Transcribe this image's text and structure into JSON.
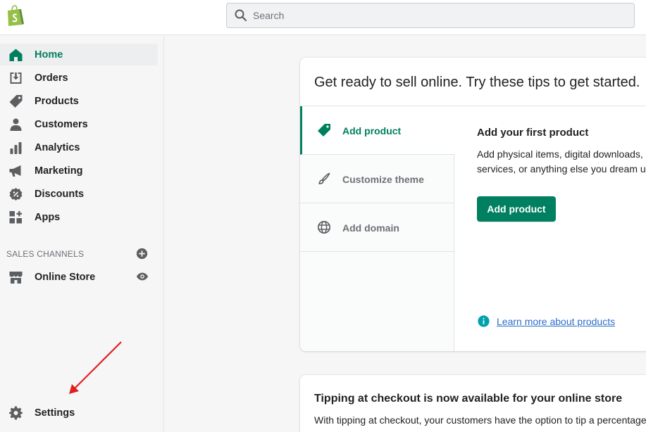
{
  "topbar": {
    "logo_icon": "shopify-bag-icon",
    "search": {
      "placeholder": "Search",
      "value": ""
    }
  },
  "sidebar": {
    "items": [
      {
        "label": "Home",
        "icon": "home-icon",
        "active": true
      },
      {
        "label": "Orders",
        "icon": "orders-icon"
      },
      {
        "label": "Products",
        "icon": "tag-icon"
      },
      {
        "label": "Customers",
        "icon": "person-icon"
      },
      {
        "label": "Analytics",
        "icon": "bar-chart-icon"
      },
      {
        "label": "Marketing",
        "icon": "megaphone-icon"
      },
      {
        "label": "Discounts",
        "icon": "discount-icon"
      },
      {
        "label": "Apps",
        "icon": "apps-icon"
      }
    ],
    "sales_channels_heading": "SALES CHANNELS",
    "online_store": {
      "label": "Online Store",
      "icon": "store-icon",
      "action_icon": "eye-icon"
    },
    "settings": {
      "label": "Settings",
      "icon": "gear-icon"
    }
  },
  "setup_card": {
    "title": "Get ready to sell online. Try these tips to get started.",
    "tabs": [
      {
        "label": "Add product",
        "icon": "tag-icon",
        "active": true
      },
      {
        "label": "Customize theme",
        "icon": "brush-icon"
      },
      {
        "label": "Add domain",
        "icon": "globe-icon"
      }
    ],
    "panel": {
      "title": "Add your first product",
      "text": "Add physical items, digital downloads, services, or anything else you dream up",
      "button_label": "Add product",
      "link_label": "Learn more about products"
    }
  },
  "tipping_card": {
    "title": "Tipping at checkout is now available for your online store",
    "text": "With tipping at checkout, your customers have the option to tip a percentage"
  },
  "colors": {
    "accent": "#008060",
    "active_text": "#007f5f",
    "link": "#2c6ecb",
    "annotation_arrow": "#e02020"
  }
}
